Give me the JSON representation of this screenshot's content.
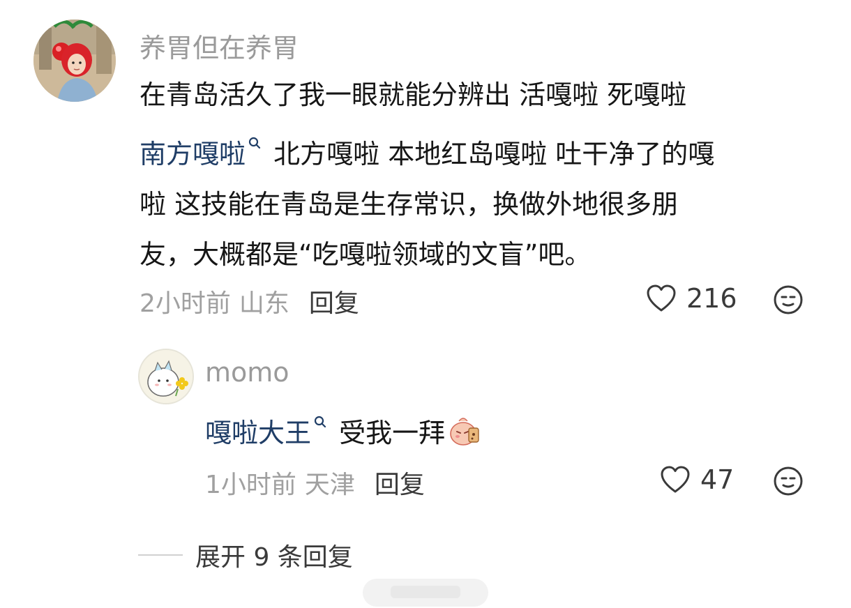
{
  "main_comment": {
    "username": "养胃但在养胃",
    "text_lines": [
      "在青岛活久了我一眼就能分辨出 活嘎啦 死嘎啦",
      "北方嘎啦 本地红岛嘎啦 吐干净了的嘎",
      "啦 这技能在青岛是生存常识，换做外地很多朋",
      "友，大概都是“吃嘎啦领域的文盲”吧。"
    ],
    "mention": "南方嘎啦",
    "time": "2小时前",
    "location": "山东",
    "reply_label": "回复",
    "likes": "216"
  },
  "reply_comment": {
    "username": "momo",
    "mention": "嘎啦大王",
    "text": "受我一拜",
    "time": "1小时前",
    "location": "天津",
    "reply_label": "回复",
    "likes": "47"
  },
  "expand": {
    "label": "展开 9 条回复"
  },
  "icons": {
    "like": "heart-outline-icon",
    "emoji": "face-emoji-icon",
    "mention_marker": "search-mark-icon",
    "sticker": "bowing-sticker-icon"
  },
  "colors": {
    "mention": "#1f3d66",
    "meta_gray": "#a0a0a0",
    "username_gray": "#9a9a9a",
    "text": "#161616"
  }
}
